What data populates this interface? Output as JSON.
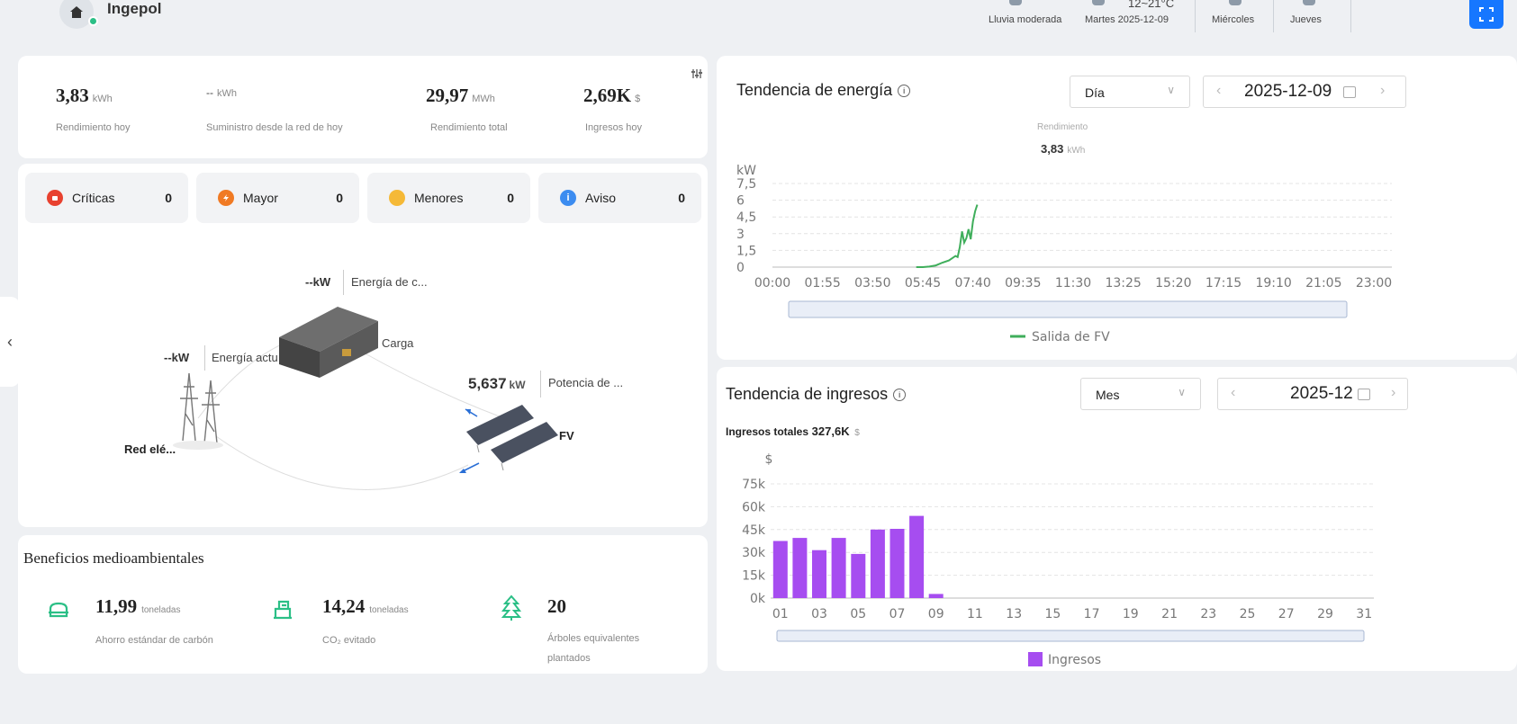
{
  "header": {
    "site_name": "Ingepol",
    "weather": [
      {
        "label": "Lluvia moderada",
        "temp": ""
      },
      {
        "label": "Martes  2025-12-09",
        "temp": "12~21°C"
      },
      {
        "label": "Miércoles",
        "temp": ""
      },
      {
        "label": "Jueves",
        "temp": ""
      }
    ],
    "icons": {
      "site": "home-icon",
      "weather": "cloud-rain-icon",
      "fullscreen": "fullscreen-icon"
    }
  },
  "kpis": [
    {
      "value": "3,83",
      "unit": "kWh",
      "label": "Rendimiento hoy"
    },
    {
      "value": "--",
      "unit": "kWh",
      "label": "Suministro desde la red de hoy"
    },
    {
      "value": "29,97",
      "unit": "MWh",
      "label": "Rendimiento total"
    },
    {
      "value": "2,69K",
      "unit": "$",
      "label": "Ingresos hoy"
    }
  ],
  "alarms": [
    {
      "label": "Críticas",
      "count": "0",
      "color": "#e8412f",
      "icon": "critical-icon"
    },
    {
      "label": "Mayor",
      "count": "0",
      "color": "#f07a24",
      "icon": "major-icon"
    },
    {
      "label": "Menores",
      "count": "0",
      "color": "#f5b937",
      "icon": "minor-icon"
    },
    {
      "label": "Aviso",
      "count": "0",
      "color": "#3c8cf0",
      "icon": "info-icon"
    }
  ],
  "flow": {
    "load_power": "--kW",
    "load_energy_label": "Energía de c...",
    "load_label": "Carga",
    "grid_power": "--kW",
    "grid_energy_label": "Energía actu",
    "grid_label": "Red elé...",
    "pv_power": "5,637",
    "pv_unit": "kW",
    "pv_power_label": "Potencia de ...",
    "pv_label": "FV"
  },
  "environment": {
    "title": "Beneficios medioambientales",
    "items": [
      {
        "value": "11,99",
        "unit": "toneladas",
        "label": "Ahorro estándar de carbón",
        "icon": "coal-icon"
      },
      {
        "value": "14,24",
        "unit": "toneladas",
        "label": "CO₂ evitado",
        "icon": "co2-icon"
      },
      {
        "value": "20",
        "unit": "",
        "label": "Árboles equivalentes plantados",
        "icon": "tree-icon"
      }
    ]
  },
  "energy_trend": {
    "title": "Tendencia de energía",
    "period": "Día",
    "date": "2025-12-09",
    "summary_label": "Rendimiento",
    "summary_value": "3,83",
    "summary_unit": "kWh",
    "legend": "Salida de FV"
  },
  "income_trend": {
    "title": "Tendencia de ingresos",
    "period": "Mes",
    "date": "2025-12",
    "total_label": "Ingresos totales",
    "total_value": "327,6K",
    "total_unit": "$",
    "legend": "Ingresos"
  },
  "colors": {
    "accent": "#1677ff",
    "line": "#3fae5b",
    "bar": "#a64df0",
    "green_icon": "#2bbf86"
  },
  "chart_data": [
    {
      "type": "line",
      "ylabel": "kW",
      "ylim": [
        0,
        7.5
      ],
      "yticks": [
        "7,5",
        "6",
        "4,5",
        "3",
        "1,5",
        "0"
      ],
      "xticks": [
        "00:00",
        "01:55",
        "03:50",
        "05:45",
        "07:40",
        "09:35",
        "11:30",
        "13:25",
        "15:20",
        "17:15",
        "19:10",
        "21:05",
        "23:00"
      ],
      "series": [
        {
          "name": "Salida de FV",
          "x": [
            "05:30",
            "05:45",
            "06:00",
            "06:15",
            "06:30",
            "06:45",
            "07:00",
            "07:05",
            "07:10",
            "07:15",
            "07:20",
            "07:25",
            "07:30",
            "07:35",
            "07:40",
            "07:45",
            "07:50"
          ],
          "values": [
            0,
            0,
            0.05,
            0.15,
            0.4,
            0.6,
            1.0,
            0.9,
            1.8,
            3.2,
            2.2,
            2.6,
            3.4,
            2.5,
            4.1,
            5.0,
            5.6
          ]
        }
      ],
      "grid": true,
      "legend": "bottom"
    },
    {
      "type": "bar",
      "ylabel": "$",
      "ylim": [
        0,
        75000
      ],
      "yticks": [
        "75k",
        "60k",
        "45k",
        "30k",
        "15k",
        "0k"
      ],
      "categories": [
        "01",
        "02",
        "03",
        "04",
        "05",
        "06",
        "07",
        "08",
        "09",
        "10",
        "11",
        "12",
        "13",
        "14",
        "15",
        "16",
        "17",
        "18",
        "19",
        "20",
        "21",
        "22",
        "23",
        "24",
        "25",
        "26",
        "27",
        "28",
        "29",
        "30",
        "31"
      ],
      "xtick_labels": [
        "01",
        "03",
        "05",
        "07",
        "09",
        "11",
        "13",
        "15",
        "17",
        "19",
        "21",
        "23",
        "25",
        "27",
        "29",
        "31"
      ],
      "series": [
        {
          "name": "Ingresos",
          "values": [
            37500,
            39500,
            31500,
            39500,
            29000,
            45000,
            45500,
            54000,
            2690,
            0,
            0,
            0,
            0,
            0,
            0,
            0,
            0,
            0,
            0,
            0,
            0,
            0,
            0,
            0,
            0,
            0,
            0,
            0,
            0,
            0,
            0
          ]
        }
      ],
      "grid": true,
      "legend": "bottom"
    }
  ]
}
